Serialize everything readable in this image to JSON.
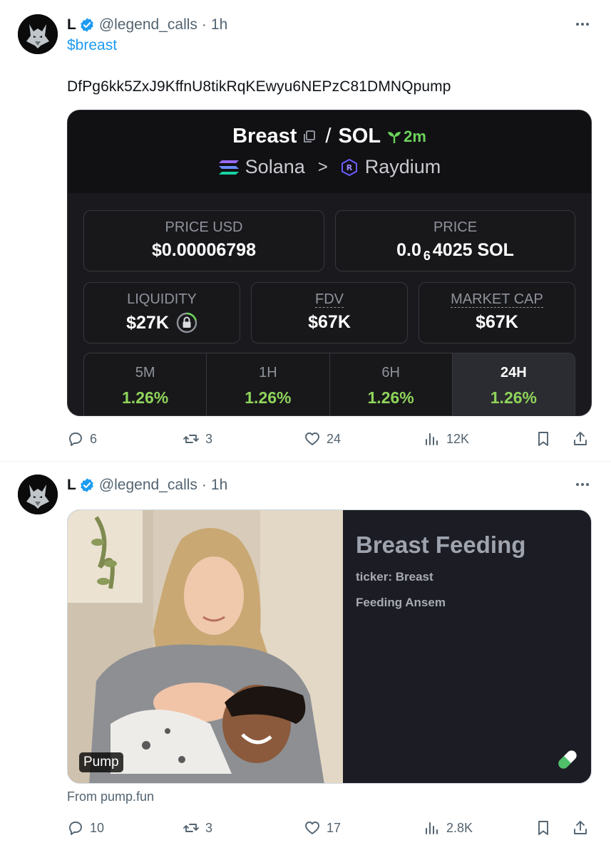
{
  "tweets": [
    {
      "author": {
        "name": "L",
        "handle": "@legend_calls",
        "separator": "·",
        "time": "1h"
      },
      "cashtag": "$breast",
      "contract": "DfPg6kk5ZxJ9KffnU8tikRqKEwyu6NEPzC81DMNQpump",
      "dex_card": {
        "base": "Breast",
        "slash": "/",
        "quote": "SOL",
        "age": "2m",
        "chain": "Solana",
        "chevron": ">",
        "dex": "Raydium",
        "price_usd_label": "PRICE USD",
        "price_usd": "$0.00006798",
        "price_label": "PRICE",
        "price_prefix": "0.0",
        "price_zeros": "6",
        "price_suffix": "4025 SOL",
        "liquidity_label": "LIQUIDITY",
        "liquidity": "$27K",
        "fdv_label": "FDV",
        "fdv": "$67K",
        "mcap_label": "MARKET CAP",
        "mcap": "$67K",
        "changes": [
          {
            "label": "5M",
            "value": "1.26%"
          },
          {
            "label": "1H",
            "value": "1.26%"
          },
          {
            "label": "6H",
            "value": "1.26%"
          },
          {
            "label": "24H",
            "value": "1.26%"
          }
        ]
      },
      "stats": {
        "replies": "6",
        "reposts": "3",
        "likes": "24",
        "views": "12K"
      }
    },
    {
      "author": {
        "name": "L",
        "handle": "@legend_calls",
        "separator": "·",
        "time": "1h"
      },
      "link_card": {
        "badge": "Pump",
        "title": "Breast Feeding",
        "ticker": "ticker: Breast",
        "description": "Feeding Ansem",
        "source": "From pump.fun"
      },
      "stats": {
        "replies": "10",
        "reposts": "3",
        "likes": "17",
        "views": "2.8K"
      }
    }
  ],
  "colors": {
    "accent": "#1d9bf0",
    "text_secondary": "#536471",
    "positive": "#8fd45a",
    "card_bg": "#1a1a1e"
  },
  "icons": [
    "wolf-avatar-icon",
    "verified-badge-icon",
    "more-icon",
    "copy-icon",
    "seedling-icon",
    "solana-icon",
    "raydium-icon",
    "lock-icon",
    "reply-icon",
    "repost-icon",
    "like-icon",
    "views-icon",
    "bookmark-icon",
    "share-icon",
    "pill-icon"
  ]
}
